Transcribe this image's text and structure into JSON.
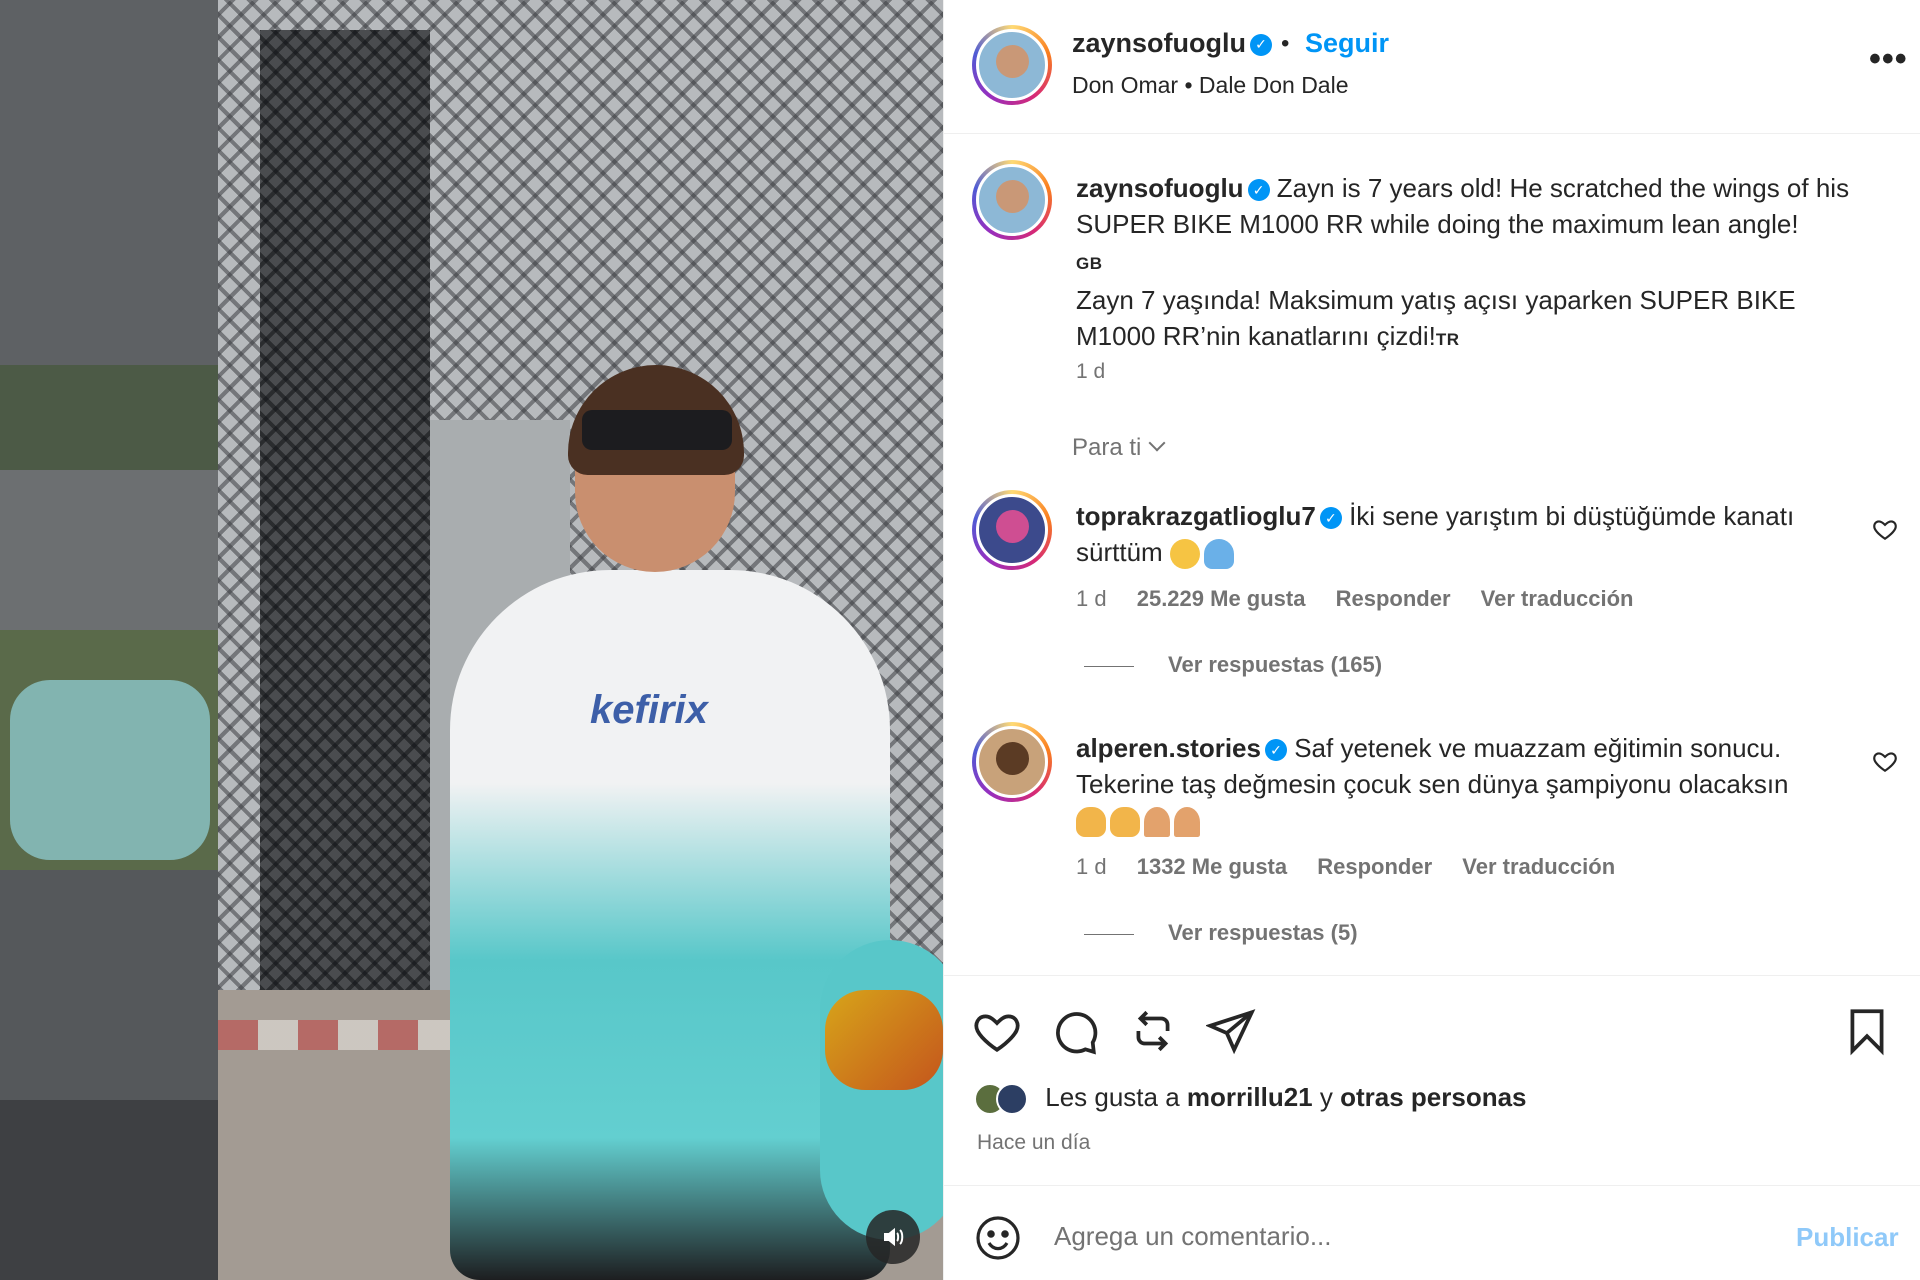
{
  "post": {
    "username": "zaynsofuoglu",
    "follow_label": "Seguir",
    "separator": "•",
    "audio": "Don Omar • Dale Don Dale",
    "more_label": "•••"
  },
  "caption": {
    "username": "zaynsofuoglu",
    "text_en": "Zayn is 7 years old! He scratched the wings of his SUPER BIKE M1000 RR while doing the maximum lean angle!",
    "lang_en": "GB",
    "text_tr": "Zayn 7 yaşında! Maksimum yatış açısı yaparken SUPER BIKE M1000 RR’nin kanatlarını çizdi!",
    "lang_tr": "TR",
    "time": "1 d"
  },
  "filter_label": "Para ti",
  "comments": [
    {
      "username": "toprakrazgatlioglu7",
      "text": "İki sene yarıştım bi düştüğümde kanatı sürttüm",
      "time": "1 d",
      "likes": "25.229 Me gusta",
      "reply_label": "Responder",
      "translate_label": "Ver traducción",
      "replies_label": "Ver respuestas (165)"
    },
    {
      "username": "alperen.stories",
      "text": "Saf yetenek ve muazzam eğitimin sonucu. Tekerine taş değmesin çocuk sen dünya şampiyonu olacaksın",
      "time": "1 d",
      "likes": "1332 Me gusta",
      "reply_label": "Responder",
      "translate_label": "Ver traducción",
      "replies_label": "Ver respuestas (5)"
    }
  ],
  "media": {
    "brand_text": "kefirix"
  },
  "likes_summary": {
    "prefix": "Les gusta a",
    "user": "morrillu21",
    "joiner": "y",
    "others": "otras personas",
    "ago": "Hace un día"
  },
  "comment_box": {
    "placeholder": "Agrega un comentario...",
    "publish_label": "Publicar"
  },
  "icons": {
    "header_more": "more-horizontal-icon",
    "sound": "volume-icon",
    "like": "heart-icon",
    "comment": "comment-bubble-icon",
    "repost": "repost-icon",
    "share": "send-icon",
    "save": "bookmark-icon",
    "emoji": "emoji-smile-icon"
  },
  "colors": {
    "accent": "#0095f6",
    "publish_disabled": "#8fc9f9",
    "secondary_text": "#737373",
    "primary_text": "#262626"
  }
}
